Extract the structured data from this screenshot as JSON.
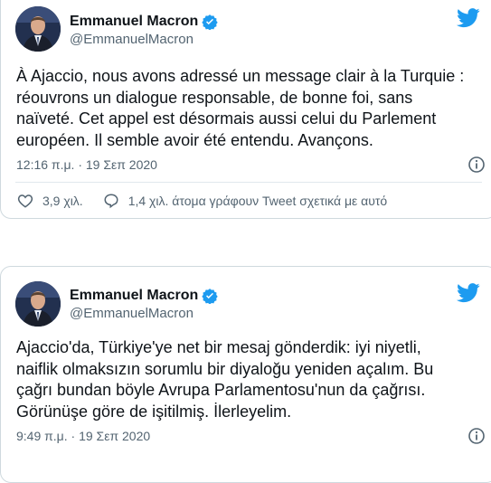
{
  "brand_color": "#1d9bf0",
  "tweets": [
    {
      "author": {
        "name": "Emmanuel Macron",
        "handle": "@EmmanuelMacron",
        "verified": true
      },
      "text": "À Ajaccio, nous avons adressé un message clair à la Turquie :\nréouvrons un dialogue responsable, de bonne foi, sans\nnaïveté. Cet appel est désormais aussi celui du Parlement\neuropéen. Il semble avoir été entendu. Avançons.",
      "timestamp": "12:16 π.μ. · 19 Σεπ 2020",
      "likes": "3,9 χιλ.",
      "conversation": "1,4 χιλ. άτομα γράφουν Tweet σχετικά με αυτό",
      "icons": {
        "logo": "twitter-bird-icon",
        "info": "info-icon",
        "like": "heart-icon",
        "reply": "speech-bubble-icon"
      }
    },
    {
      "author": {
        "name": "Emmanuel Macron",
        "handle": "@EmmanuelMacron",
        "verified": true
      },
      "text": "Ajaccio'da, Türkiye'ye net bir mesaj gönderdik: iyi niyetli,\nnaiflik olmaksızın sorumlu bir diyaloğu yeniden açalım. Bu\nçağrı bundan böyle Avrupa Parlamentosu'nun da çağrısı.\nGörünüşe göre de işitilmiş. İlerleyelim.",
      "timestamp": "9:49 π.μ. · 19 Σεπ 2020",
      "icons": {
        "logo": "twitter-bird-icon",
        "info": "info-icon"
      }
    }
  ]
}
